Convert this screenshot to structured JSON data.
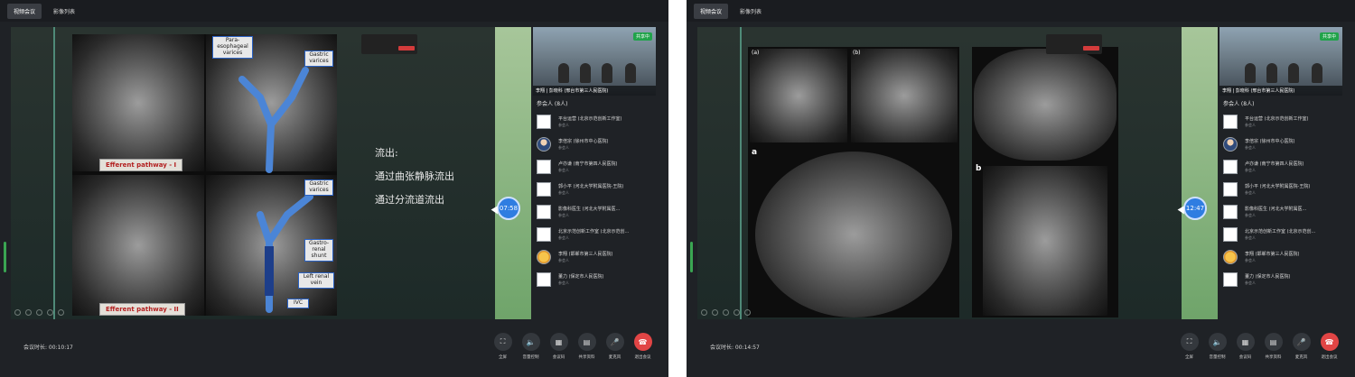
{
  "tabs": {
    "meeting": "视频会议",
    "history": "影像列表"
  },
  "windows": [
    {
      "duration": "会议时长: 00:10:17",
      "timer": "07:58",
      "slide_text": [
        "流出:",
        "通过曲张静脉流出",
        "通过分流道流出"
      ],
      "labels": {
        "para_esophageal": "Para-\nesophageal\nvarices",
        "gastric_top": "Gastric\nvarices",
        "gastric_mid": "Gastric\nvarices",
        "gastro_renal": "Gastro-\nrenal\nshunt",
        "left_renal": "Left renal\nvein",
        "ivc": "IVC",
        "pathway1": "Efferent pathway - I",
        "pathway2": "Efferent pathway - II"
      }
    },
    {
      "duration": "会议时长: 00:14:57",
      "timer": "12:47",
      "panel_labels": {
        "a_top": "(a)",
        "b_top": "(b)",
        "a": "a",
        "b": "b"
      }
    }
  ],
  "video": {
    "share": "共享中",
    "caption": "李翔 | 彭晓科 (邢台市第三人民医院)"
  },
  "roster": {
    "title": "参会人 (8人)",
    "items": [
      {
        "name": "平台运营 (北京示范创新工作室)",
        "role": "参会人",
        "avatar": "blank"
      },
      {
        "name": "李倍宗 (徐州市中心医院)",
        "role": "参会人",
        "avatar": "photo"
      },
      {
        "name": "卢亦谦 (南宁市第四人民医院)",
        "role": "参会人",
        "avatar": "blank"
      },
      {
        "name": "郭小平 (河北大学附属医院-王院)",
        "role": "参会人",
        "avatar": "blank"
      },
      {
        "name": "影像科医生 (河北大学附属医...",
        "role": "参会人",
        "avatar": "blank"
      },
      {
        "name": "北京示范创新工作室 (北京示范创...",
        "role": "参会人",
        "avatar": "blank"
      },
      {
        "name": "李翔 (邯郸市第三人民医院)",
        "role": "参会人",
        "avatar": "cartoon"
      },
      {
        "name": "董力 (保定市人民医院)",
        "role": "参会人",
        "avatar": "blank"
      }
    ]
  },
  "controls": [
    {
      "label": "全屏",
      "icon": "fullscreen-icon",
      "glyph": "⛶"
    },
    {
      "label": "音量控制",
      "icon": "volume-icon",
      "glyph": "🔈"
    },
    {
      "label": "会议码",
      "icon": "qr-code-icon",
      "glyph": "▦"
    },
    {
      "label": "共享资料",
      "icon": "document-icon",
      "glyph": "▤"
    },
    {
      "label": "麦克风",
      "icon": "microphone-icon",
      "glyph": "🎤"
    },
    {
      "label": "退出会议",
      "icon": "hang-up-icon",
      "glyph": "☎"
    }
  ]
}
